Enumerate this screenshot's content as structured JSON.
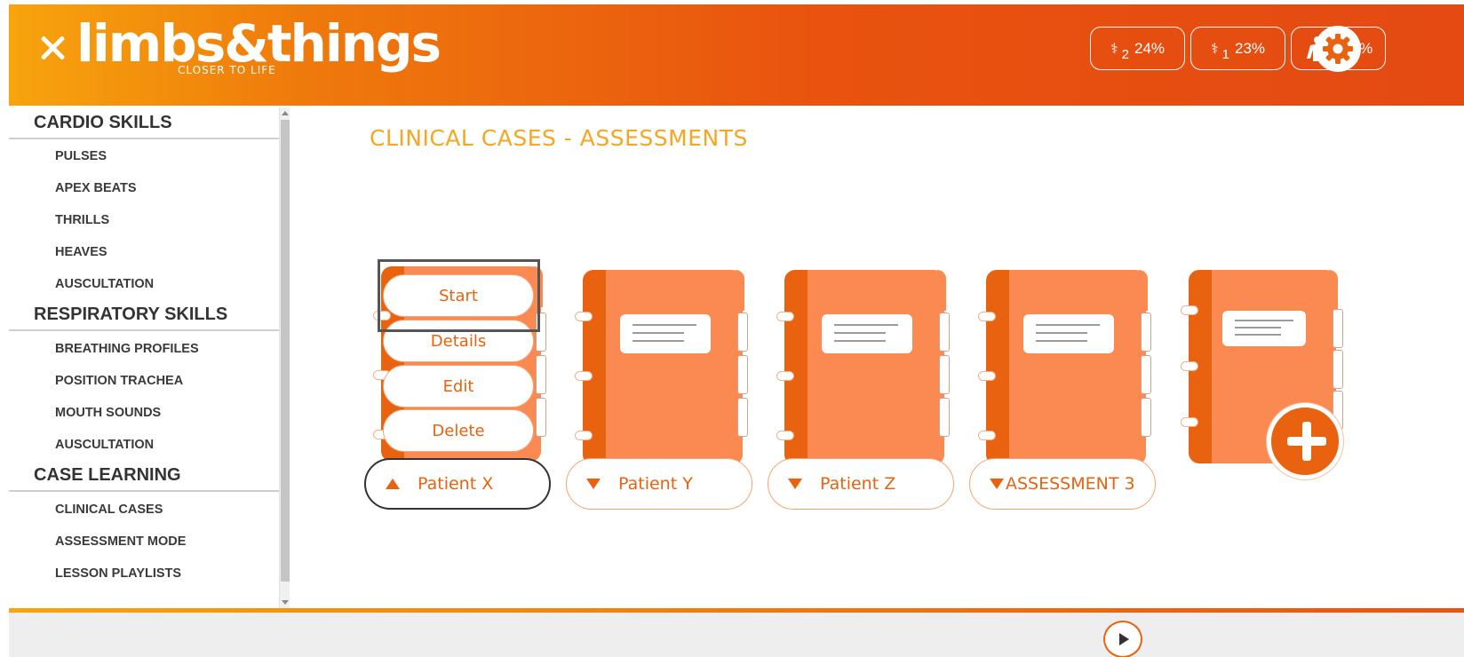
{
  "header": {
    "logo_text": "limbs&things",
    "logo_tagline": "CLOSER TO LIFE",
    "stats": [
      {
        "icon": "stethoscope-icon",
        "sub": "2",
        "value": "24%"
      },
      {
        "icon": "stethoscope-icon",
        "sub": "1",
        "value": "23%"
      },
      {
        "icon": "body-icon",
        "sub": "",
        "value": "100%"
      }
    ]
  },
  "sidebar": {
    "sections": [
      {
        "title": "CARDIO SKILLS",
        "items": [
          "PULSES",
          "APEX BEATS",
          "THRILLS",
          "HEAVES",
          "AUSCULTATION"
        ]
      },
      {
        "title": "RESPIRATORY SKILLS",
        "items": [
          "BREATHING PROFILES",
          "POSITION TRACHEA",
          "MOUTH SOUNDS",
          "AUSCULTATION"
        ]
      },
      {
        "title": "CASE LEARNING",
        "items": [
          "CLINICAL CASES",
          "ASSESSMENT MODE",
          "LESSON PLAYLISTS"
        ]
      }
    ]
  },
  "main": {
    "title": "CLINICAL CASES - ASSESSMENTS",
    "menu": {
      "start": "Start",
      "details": "Details",
      "edit": "Edit",
      "delete": "Delete"
    },
    "cases": [
      {
        "label": "Patient X",
        "expanded": true
      },
      {
        "label": "Patient Y",
        "expanded": false
      },
      {
        "label": "Patient Z",
        "expanded": false
      },
      {
        "label": "ASSESSMENT 3",
        "expanded": false
      }
    ]
  },
  "colors": {
    "accent": "#e8620f",
    "title": "#f5a623",
    "header_start": "#f7a40d",
    "header_end": "#e44a12"
  }
}
